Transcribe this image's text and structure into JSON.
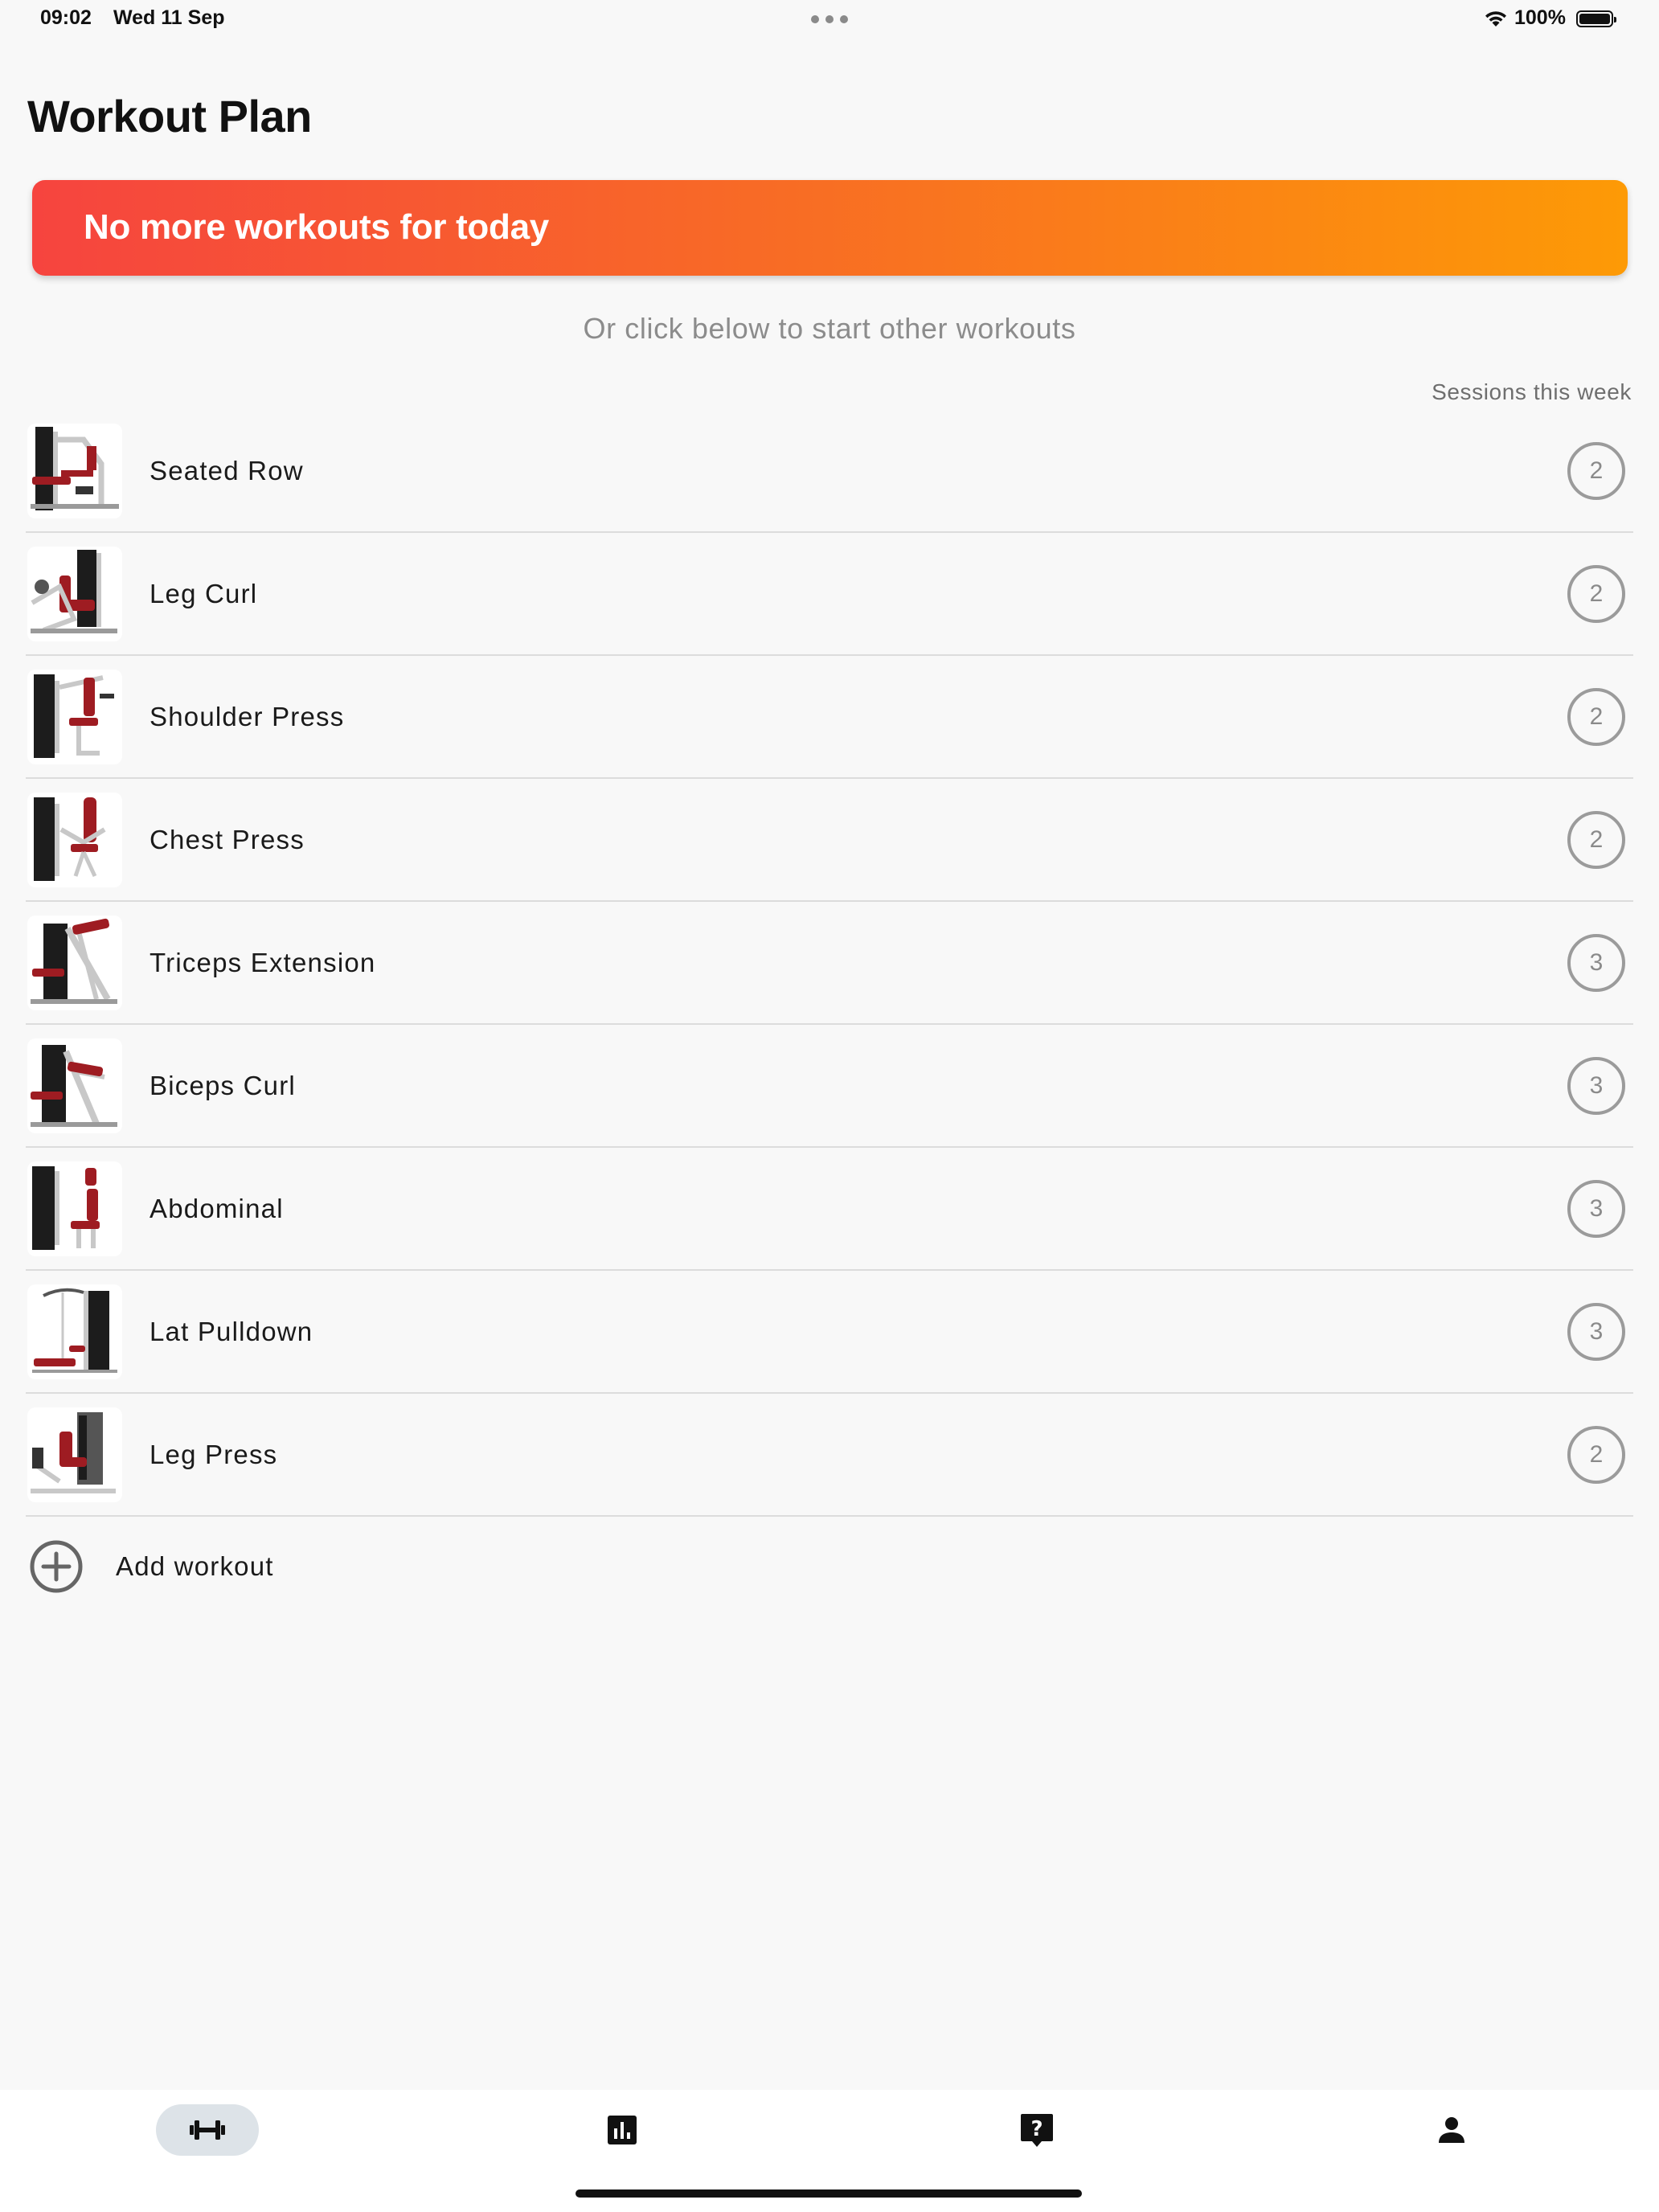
{
  "status_bar": {
    "time": "09:02",
    "date": "Wed 11 Sep",
    "battery": "100%"
  },
  "page_title": "Workout Plan",
  "banner": {
    "text": "No more workouts for today",
    "gradient_start": "#f6443f",
    "gradient_end": "#fd9a06"
  },
  "subtitle": "Or click below to start other workouts",
  "sessions_header": "Sessions this week",
  "workouts": [
    {
      "name": "Seated Row",
      "sessions": "2",
      "icon": "seated-row-machine-icon"
    },
    {
      "name": "Leg Curl",
      "sessions": "2",
      "icon": "leg-curl-machine-icon"
    },
    {
      "name": "Shoulder Press",
      "sessions": "2",
      "icon": "shoulder-press-machine-icon"
    },
    {
      "name": "Chest Press",
      "sessions": "2",
      "icon": "chest-press-machine-icon"
    },
    {
      "name": "Triceps Extension",
      "sessions": "3",
      "icon": "triceps-extension-machine-icon"
    },
    {
      "name": "Biceps Curl",
      "sessions": "3",
      "icon": "biceps-curl-machine-icon"
    },
    {
      "name": "Abdominal",
      "sessions": "3",
      "icon": "abdominal-machine-icon"
    },
    {
      "name": "Lat Pulldown",
      "sessions": "3",
      "icon": "lat-pulldown-machine-icon"
    },
    {
      "name": "Leg Press",
      "sessions": "2",
      "icon": "leg-press-machine-icon"
    }
  ],
  "add_workout": {
    "label": "Add workout",
    "icon": "plus-circle-icon"
  },
  "tab_bar": {
    "tabs": [
      {
        "icon": "dumbbell-icon",
        "active": true
      },
      {
        "icon": "bar-chart-icon",
        "active": false
      },
      {
        "icon": "help-icon",
        "active": false
      },
      {
        "icon": "person-icon",
        "active": false
      }
    ]
  },
  "colors": {
    "accent_red": "#9e1c22",
    "machine_black": "#1c1c1c",
    "machine_frame": "#c8c8c8"
  }
}
